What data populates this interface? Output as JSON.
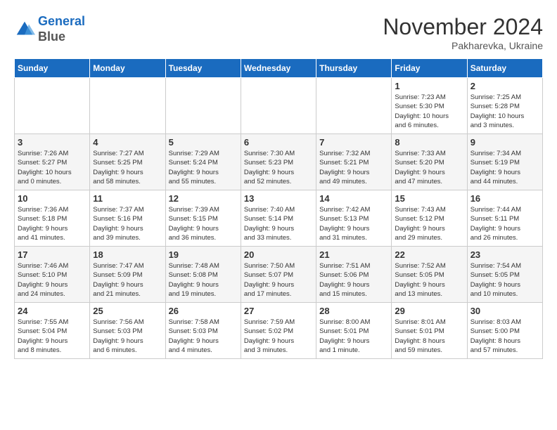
{
  "header": {
    "logo_line1": "General",
    "logo_line2": "Blue",
    "month": "November 2024",
    "location": "Pakharevka, Ukraine"
  },
  "weekdays": [
    "Sunday",
    "Monday",
    "Tuesday",
    "Wednesday",
    "Thursday",
    "Friday",
    "Saturday"
  ],
  "weeks": [
    [
      {
        "day": "",
        "info": ""
      },
      {
        "day": "",
        "info": ""
      },
      {
        "day": "",
        "info": ""
      },
      {
        "day": "",
        "info": ""
      },
      {
        "day": "",
        "info": ""
      },
      {
        "day": "1",
        "info": "Sunrise: 7:23 AM\nSunset: 5:30 PM\nDaylight: 10 hours\nand 6 minutes."
      },
      {
        "day": "2",
        "info": "Sunrise: 7:25 AM\nSunset: 5:28 PM\nDaylight: 10 hours\nand 3 minutes."
      }
    ],
    [
      {
        "day": "3",
        "info": "Sunrise: 7:26 AM\nSunset: 5:27 PM\nDaylight: 10 hours\nand 0 minutes."
      },
      {
        "day": "4",
        "info": "Sunrise: 7:27 AM\nSunset: 5:25 PM\nDaylight: 9 hours\nand 58 minutes."
      },
      {
        "day": "5",
        "info": "Sunrise: 7:29 AM\nSunset: 5:24 PM\nDaylight: 9 hours\nand 55 minutes."
      },
      {
        "day": "6",
        "info": "Sunrise: 7:30 AM\nSunset: 5:23 PM\nDaylight: 9 hours\nand 52 minutes."
      },
      {
        "day": "7",
        "info": "Sunrise: 7:32 AM\nSunset: 5:21 PM\nDaylight: 9 hours\nand 49 minutes."
      },
      {
        "day": "8",
        "info": "Sunrise: 7:33 AM\nSunset: 5:20 PM\nDaylight: 9 hours\nand 47 minutes."
      },
      {
        "day": "9",
        "info": "Sunrise: 7:34 AM\nSunset: 5:19 PM\nDaylight: 9 hours\nand 44 minutes."
      }
    ],
    [
      {
        "day": "10",
        "info": "Sunrise: 7:36 AM\nSunset: 5:18 PM\nDaylight: 9 hours\nand 41 minutes."
      },
      {
        "day": "11",
        "info": "Sunrise: 7:37 AM\nSunset: 5:16 PM\nDaylight: 9 hours\nand 39 minutes."
      },
      {
        "day": "12",
        "info": "Sunrise: 7:39 AM\nSunset: 5:15 PM\nDaylight: 9 hours\nand 36 minutes."
      },
      {
        "day": "13",
        "info": "Sunrise: 7:40 AM\nSunset: 5:14 PM\nDaylight: 9 hours\nand 33 minutes."
      },
      {
        "day": "14",
        "info": "Sunrise: 7:42 AM\nSunset: 5:13 PM\nDaylight: 9 hours\nand 31 minutes."
      },
      {
        "day": "15",
        "info": "Sunrise: 7:43 AM\nSunset: 5:12 PM\nDaylight: 9 hours\nand 29 minutes."
      },
      {
        "day": "16",
        "info": "Sunrise: 7:44 AM\nSunset: 5:11 PM\nDaylight: 9 hours\nand 26 minutes."
      }
    ],
    [
      {
        "day": "17",
        "info": "Sunrise: 7:46 AM\nSunset: 5:10 PM\nDaylight: 9 hours\nand 24 minutes."
      },
      {
        "day": "18",
        "info": "Sunrise: 7:47 AM\nSunset: 5:09 PM\nDaylight: 9 hours\nand 21 minutes."
      },
      {
        "day": "19",
        "info": "Sunrise: 7:48 AM\nSunset: 5:08 PM\nDaylight: 9 hours\nand 19 minutes."
      },
      {
        "day": "20",
        "info": "Sunrise: 7:50 AM\nSunset: 5:07 PM\nDaylight: 9 hours\nand 17 minutes."
      },
      {
        "day": "21",
        "info": "Sunrise: 7:51 AM\nSunset: 5:06 PM\nDaylight: 9 hours\nand 15 minutes."
      },
      {
        "day": "22",
        "info": "Sunrise: 7:52 AM\nSunset: 5:05 PM\nDaylight: 9 hours\nand 13 minutes."
      },
      {
        "day": "23",
        "info": "Sunrise: 7:54 AM\nSunset: 5:05 PM\nDaylight: 9 hours\nand 10 minutes."
      }
    ],
    [
      {
        "day": "24",
        "info": "Sunrise: 7:55 AM\nSunset: 5:04 PM\nDaylight: 9 hours\nand 8 minutes."
      },
      {
        "day": "25",
        "info": "Sunrise: 7:56 AM\nSunset: 5:03 PM\nDaylight: 9 hours\nand 6 minutes."
      },
      {
        "day": "26",
        "info": "Sunrise: 7:58 AM\nSunset: 5:03 PM\nDaylight: 9 hours\nand 4 minutes."
      },
      {
        "day": "27",
        "info": "Sunrise: 7:59 AM\nSunset: 5:02 PM\nDaylight: 9 hours\nand 3 minutes."
      },
      {
        "day": "28",
        "info": "Sunrise: 8:00 AM\nSunset: 5:01 PM\nDaylight: 9 hours\nand 1 minute."
      },
      {
        "day": "29",
        "info": "Sunrise: 8:01 AM\nSunset: 5:01 PM\nDaylight: 8 hours\nand 59 minutes."
      },
      {
        "day": "30",
        "info": "Sunrise: 8:03 AM\nSunset: 5:00 PM\nDaylight: 8 hours\nand 57 minutes."
      }
    ]
  ]
}
